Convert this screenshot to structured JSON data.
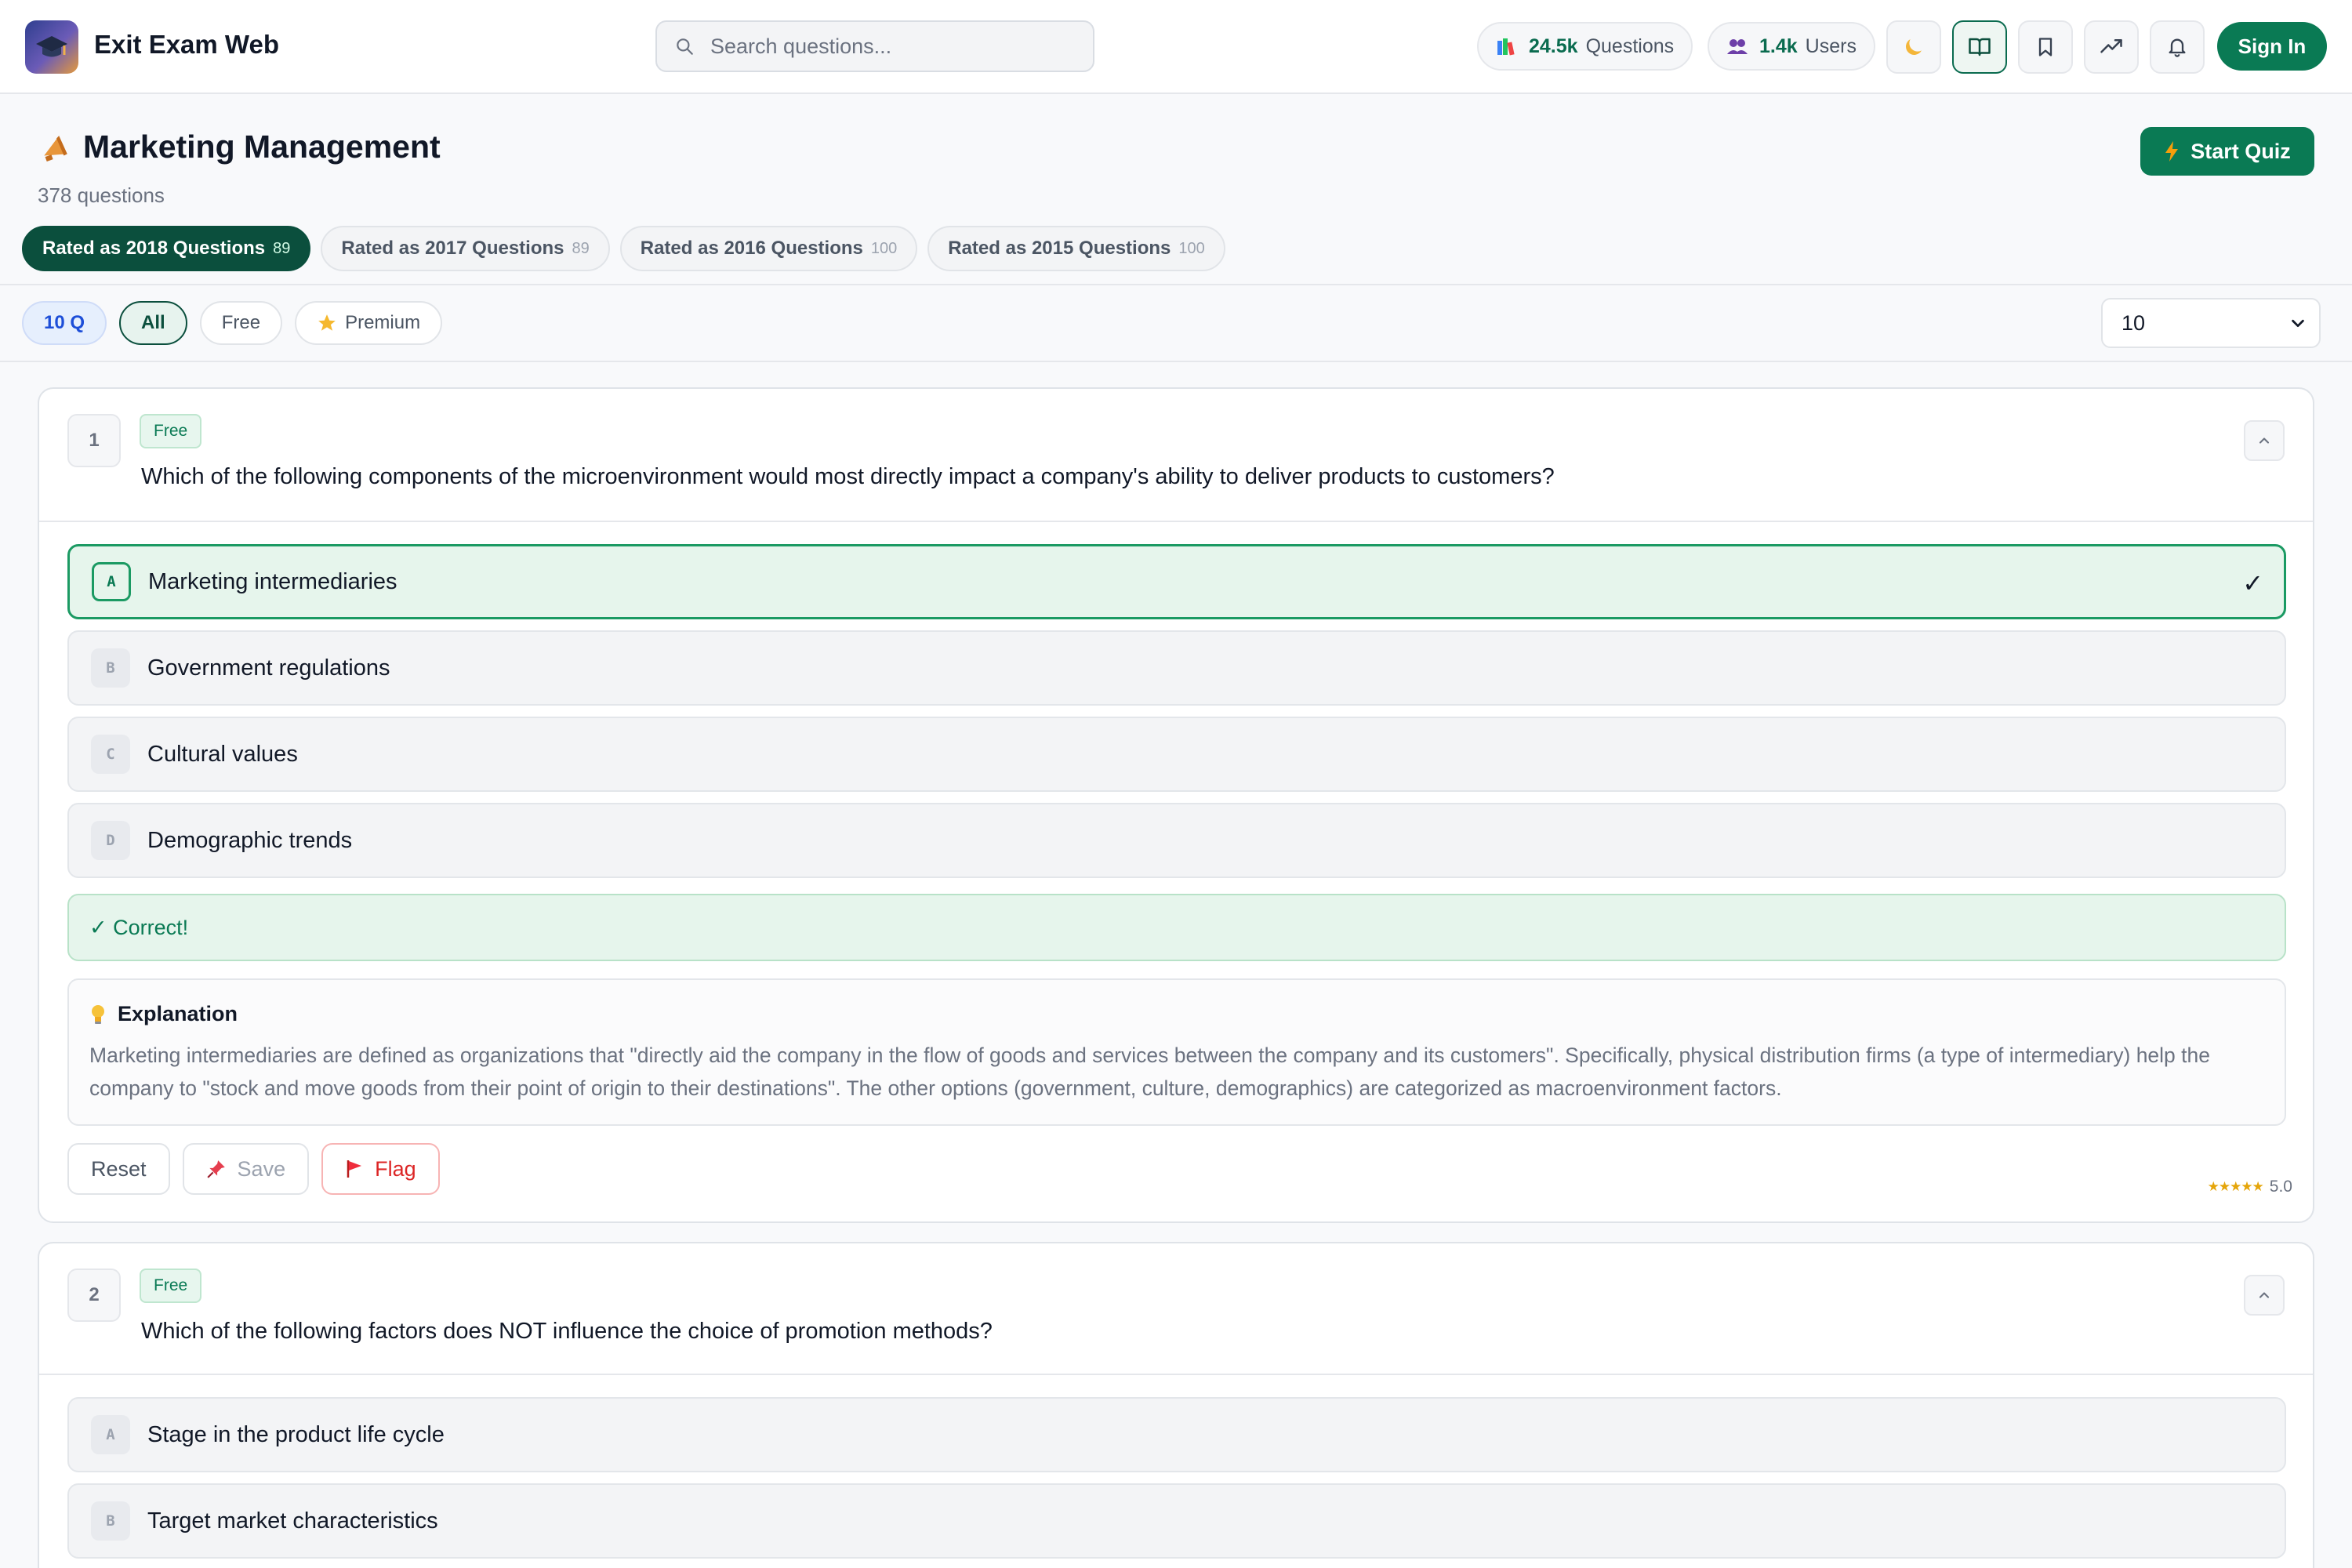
{
  "header": {
    "brand": "Exit Exam Web",
    "search_placeholder": "Search questions...",
    "stats": [
      {
        "value": "24.5k",
        "label": "Questions",
        "icon": "books-icon"
      },
      {
        "value": "1.4k",
        "label": "Users",
        "icon": "users-icon"
      }
    ],
    "sign_in": "Sign In"
  },
  "page": {
    "title": "Marketing Management",
    "count": "378 questions",
    "start_quiz": "Start Quiz"
  },
  "year_tabs": [
    {
      "label": "Rated as 2018 Questions",
      "count": "89",
      "active": true
    },
    {
      "label": "Rated as 2017 Questions",
      "count": "89",
      "active": false
    },
    {
      "label": "Rated as 2016 Questions",
      "count": "100",
      "active": false
    },
    {
      "label": "Rated as 2015 Questions",
      "count": "100",
      "active": false
    }
  ],
  "filters": {
    "count_chip": "10 Q",
    "all": "All",
    "free": "Free",
    "premium": "Premium",
    "per_page": "10"
  },
  "questions": [
    {
      "number": "1",
      "badge": "Free",
      "text": "Which of the following components of the microenvironment would most directly impact a company's ability to deliver products to customers?",
      "options": [
        {
          "letter": "A",
          "text": "Marketing intermediaries",
          "correct": true
        },
        {
          "letter": "B",
          "text": "Government regulations"
        },
        {
          "letter": "C",
          "text": "Cultural values"
        },
        {
          "letter": "D",
          "text": "Demographic trends"
        }
      ],
      "feedback": "✓ Correct!",
      "explanation_title": "Explanation",
      "explanation": "Marketing intermediaries are defined as organizations that \"directly aid the company in the flow of goods and services between the company and its customers\". Specifically, physical distribution firms (a type of intermediary) help the company to \"stock and move goods from their point of origin to their destinations\". The other options (government, culture, demographics) are categorized as macroenvironment factors.",
      "actions": {
        "reset": "Reset",
        "save": "Save",
        "flag": "Flag"
      },
      "rating": "5.0",
      "stars": "★★★★★"
    },
    {
      "number": "2",
      "badge": "Free",
      "text": "Which of the following factors does NOT influence the choice of promotion methods?",
      "options": [
        {
          "letter": "A",
          "text": "Stage in the product life cycle"
        },
        {
          "letter": "B",
          "text": "Target market characteristics"
        }
      ]
    }
  ],
  "colors": {
    "primary": "#0a7a54",
    "primary_dark": "#0b4f3d",
    "correct_bg": "#e6f5ec",
    "flag": "#dc2626"
  }
}
